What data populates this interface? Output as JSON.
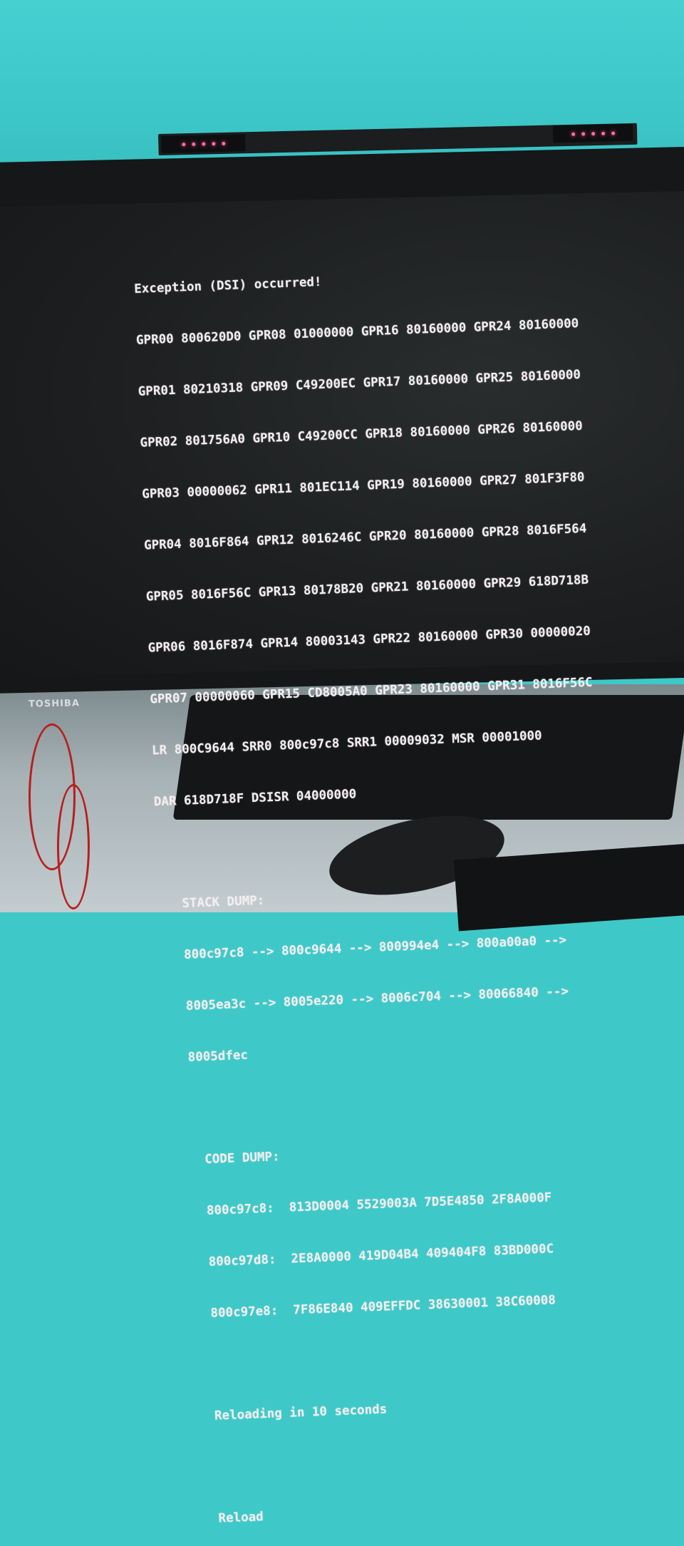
{
  "monitor": {
    "brand": "TOSHIBA"
  },
  "screen": {
    "title": "Exception (DSI) occurred!",
    "registers": [
      "GPR00 800620D0 GPR08 01000000 GPR16 80160000 GPR24 80160000",
      "GPR01 80210318 GPR09 C49200EC GPR17 80160000 GPR25 80160000",
      "GPR02 801756A0 GPR10 C49200CC GPR18 80160000 GPR26 80160000",
      "GPR03 00000062 GPR11 801EC114 GPR19 80160000 GPR27 801F3F80",
      "GPR04 8016F864 GPR12 8016246C GPR20 80160000 GPR28 8016F564",
      "GPR05 8016F56C GPR13 80178B20 GPR21 80160000 GPR29 618D718B",
      "GPR06 8016F874 GPR14 80003143 GPR22 80160000 GPR30 00000020",
      "GPR07 00000060 GPR15 CD8005A0 GPR23 80160000 GPR31 8016F56C",
      "LR 800C9644 SRR0 800c97c8 SRR1 00009032 MSR 00001000",
      "DAR 618D718F DSISR 04000000"
    ],
    "stack_dump": {
      "heading": "STACK DUMP:",
      "lines": [
        "800c97c8 --> 800c9644 --> 800994e4 --> 800a00a0 -->",
        "8005ea3c --> 8005e220 --> 8006c704 --> 80066840 -->",
        "8005dfec"
      ]
    },
    "code_dump": {
      "heading": "CODE DUMP:",
      "lines": [
        "800c97c8:  813D0004 5529003A 7D5E4850 2F8A000F",
        "800c97d8:  2E8A0000 419D04B4 409404F8 83BD000C",
        "800c97e8:  7F86E840 409EFFDC 38630001 38C60008"
      ]
    },
    "reload_message": "Reloading in 10 seconds",
    "reload_label": "Reload"
  }
}
